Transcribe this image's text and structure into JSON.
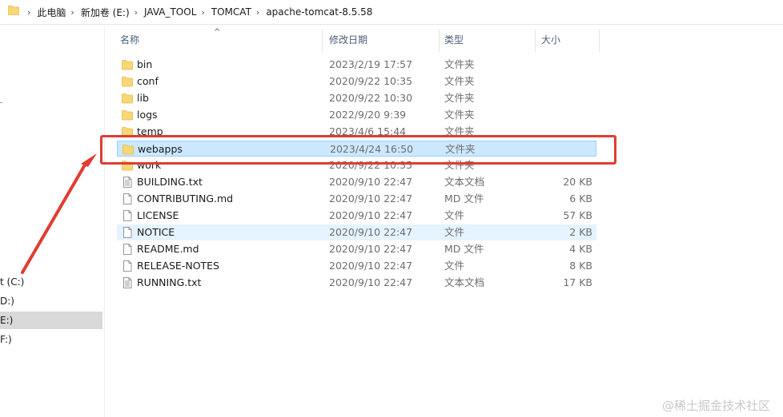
{
  "address_bar": {
    "crumbs": [
      "此电脑",
      "新加卷 (E:)",
      "JAVA_TOOL",
      "TOMCAT",
      "apache-tomcat-8.5.58"
    ]
  },
  "nav": {
    "items": [
      "t (C:)",
      "D:)",
      "E:)",
      "F:)"
    ],
    "selected_index": 2
  },
  "columns": {
    "name": "名称",
    "date": "修改日期",
    "type": "类型",
    "size": "大小"
  },
  "files": [
    {
      "name": "bin",
      "date": "2023/2/19 17:57",
      "type": "文件夹",
      "size": "",
      "icon": "folder-icon"
    },
    {
      "name": "conf",
      "date": "2020/9/22 10:35",
      "type": "文件夹",
      "size": "",
      "icon": "folder-icon"
    },
    {
      "name": "lib",
      "date": "2020/9/22 10:30",
      "type": "文件夹",
      "size": "",
      "icon": "folder-icon"
    },
    {
      "name": "logs",
      "date": "2022/9/20 9:39",
      "type": "文件夹",
      "size": "",
      "icon": "folder-icon"
    },
    {
      "name": "temp",
      "date": "2023/4/6 15:44",
      "type": "文件夹",
      "size": "",
      "icon": "folder-icon"
    },
    {
      "name": "webapps",
      "date": "2023/4/24 16:50",
      "type": "文件夹",
      "size": "",
      "icon": "folder-icon"
    },
    {
      "name": "work",
      "date": "2020/9/22 10:35",
      "type": "文件夹",
      "size": "",
      "icon": "folder-icon"
    },
    {
      "name": "BUILDING.txt",
      "date": "2020/9/10 22:47",
      "type": "文本文档",
      "size": "20 KB",
      "icon": "text-file-icon"
    },
    {
      "name": "CONTRIBUTING.md",
      "date": "2020/9/10 22:47",
      "type": "MD 文件",
      "size": "6 KB",
      "icon": "file-icon"
    },
    {
      "name": "LICENSE",
      "date": "2020/9/10 22:47",
      "type": "文件",
      "size": "57 KB",
      "icon": "file-icon"
    },
    {
      "name": "NOTICE",
      "date": "2020/9/10 22:47",
      "type": "文件",
      "size": "2 KB",
      "icon": "file-icon"
    },
    {
      "name": "README.md",
      "date": "2020/9/10 22:47",
      "type": "MD 文件",
      "size": "4 KB",
      "icon": "file-icon"
    },
    {
      "name": "RELEASE-NOTES",
      "date": "2020/9/10 22:47",
      "type": "文件",
      "size": "8 KB",
      "icon": "file-icon"
    },
    {
      "name": "RUNNING.txt",
      "date": "2020/9/10 22:47",
      "type": "文本文档",
      "size": "17 KB",
      "icon": "text-file-icon"
    }
  ],
  "selected_file_index": 5,
  "hover_file_index": 10,
  "annotation": {
    "color": "#e03c31"
  },
  "watermark": "@稀土掘金技术社区"
}
